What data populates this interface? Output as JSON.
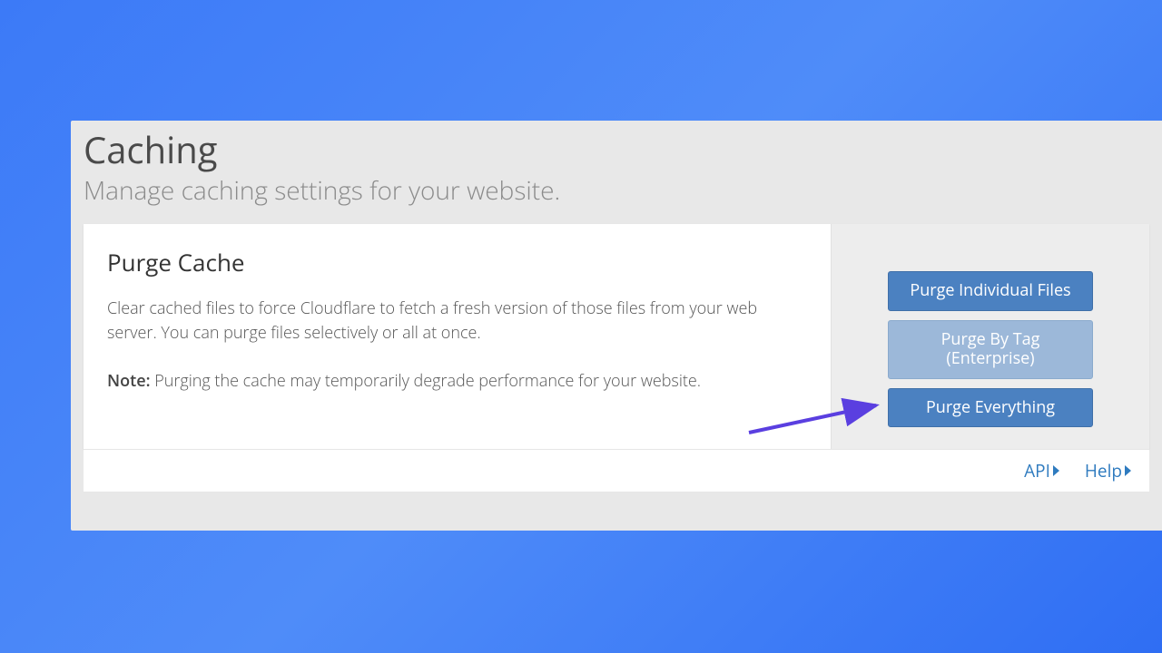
{
  "header": {
    "title": "Caching",
    "subtitle": "Manage caching settings for your website."
  },
  "card": {
    "heading": "Purge Cache",
    "description": "Clear cached files to force Cloudflare to fetch a fresh version of those files from your web server. You can purge files selectively or all at once.",
    "note_prefix": "Note:",
    "note_text": " Purging the cache may temporarily degrade performance for your website."
  },
  "actions": {
    "purge_individual": "Purge Individual Files",
    "purge_tag": "Purge By Tag (Enterprise)",
    "purge_all": "Purge Everything"
  },
  "footer": {
    "api": "API",
    "help": "Help"
  }
}
